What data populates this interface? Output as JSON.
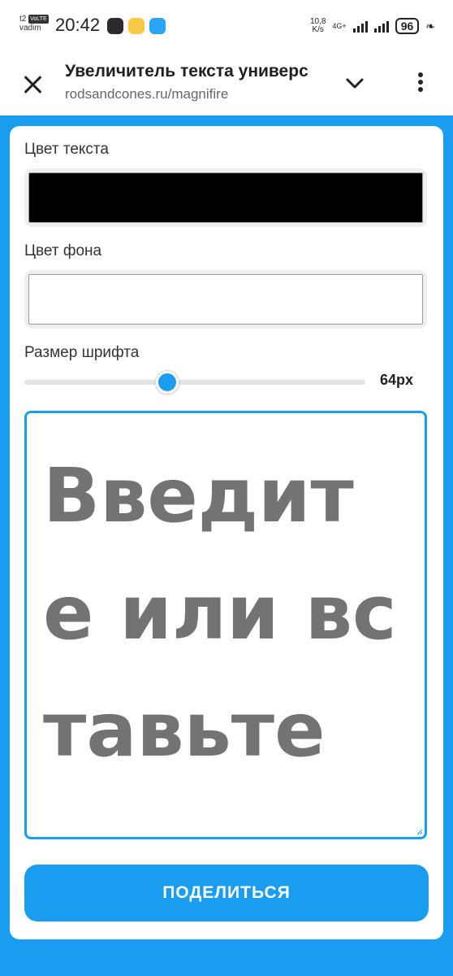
{
  "status_bar": {
    "carrier": "t2",
    "volte": "VoLTE",
    "user": "vadim",
    "time": "20:42",
    "net_speed_value": "10,8",
    "net_speed_unit": "K/s",
    "network": "4G+",
    "battery": "96"
  },
  "toolbar": {
    "title": "Увеличитель текста универс",
    "url": "rodsandcones.ru/magnifire"
  },
  "form": {
    "text_color_label": "Цвет текста",
    "text_color_value": "#000000",
    "bg_color_label": "Цвет фона",
    "bg_color_value": "#ffffff",
    "font_size_label": "Размер шрифта",
    "font_size_value": "64px",
    "font_size_fraction": 0.42,
    "text_placeholder": "Введите или вставьте",
    "share_button": "ПОДЕЛИТЬСЯ"
  },
  "colors": {
    "accent": "#1a9df0",
    "placeholder_text": "#737373"
  }
}
